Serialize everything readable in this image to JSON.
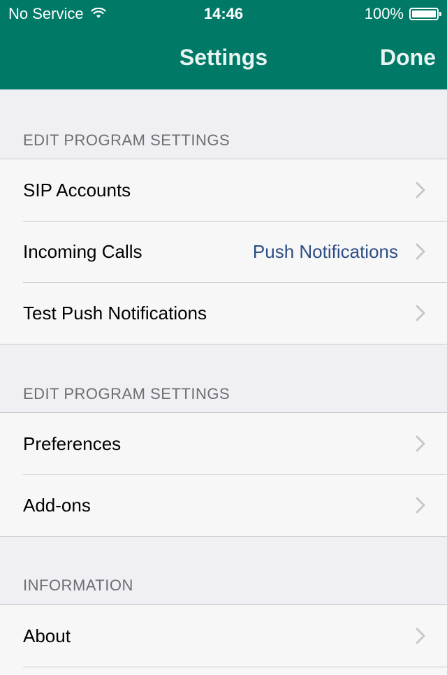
{
  "status_bar": {
    "carrier": "No Service",
    "time": "14:46",
    "battery": "100%",
    "wifi_icon": "wifi-icon",
    "battery_icon": "battery-icon"
  },
  "nav": {
    "title": "Settings",
    "done_label": "Done"
  },
  "colors": {
    "nav_bar": "#007a67",
    "background": "#efeff4",
    "cell": "#f7f7f7",
    "detail_text": "#2e4e85",
    "header_text": "#6d6d72"
  },
  "sections": [
    {
      "header": "EDIT PROGRAM SETTINGS",
      "rows": [
        {
          "label": "SIP Accounts",
          "detail": ""
        },
        {
          "label": "Incoming Calls",
          "detail": "Push Notifications"
        },
        {
          "label": "Test Push Notifications",
          "detail": ""
        }
      ]
    },
    {
      "header": "EDIT PROGRAM SETTINGS",
      "rows": [
        {
          "label": "Preferences",
          "detail": ""
        },
        {
          "label": "Add-ons",
          "detail": ""
        }
      ]
    },
    {
      "header": "INFORMATION",
      "rows": [
        {
          "label": "About",
          "detail": ""
        }
      ]
    }
  ],
  "row_accessory_icon": "chevron-right-icon"
}
